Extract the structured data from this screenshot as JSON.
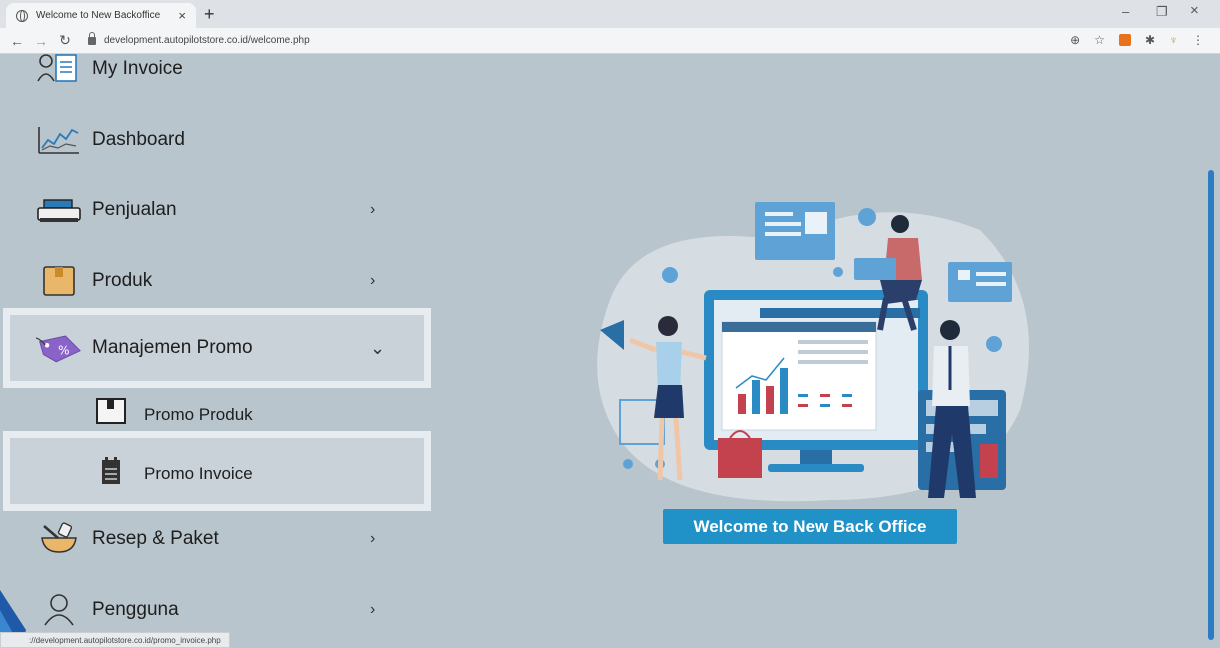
{
  "browser": {
    "tab_title": "Welcome to New Backoffice",
    "tab_close": "×",
    "new_tab": "+",
    "url": "development.autopilotstore.co.id/welcome.php",
    "status_url": "://development.autopilotstore.co.id/promo_invoice.php",
    "minimize": "–",
    "restore": "❐",
    "close": "×"
  },
  "sidebar": {
    "items": [
      {
        "label": "My Invoice",
        "icon": "invoice-icon"
      },
      {
        "label": "Dashboard",
        "icon": "dashboard-chart-icon"
      },
      {
        "label": "Penjualan",
        "icon": "cash-register-icon",
        "chevron": "›"
      },
      {
        "label": "Produk",
        "icon": "product-box-icon",
        "chevron": "›"
      },
      {
        "label": "Manajemen Promo",
        "icon": "promo-tag-icon",
        "chevron": "⌄"
      },
      {
        "label": "Resep & Paket",
        "icon": "mortar-pestle-icon",
        "chevron": "›"
      },
      {
        "label": "Pengguna",
        "icon": "user-icon",
        "chevron": "›"
      }
    ],
    "sub_items": [
      {
        "label": "Promo Produk",
        "icon": "box-icon"
      },
      {
        "label": "Promo Invoice",
        "icon": "calendar-icon"
      }
    ]
  },
  "main": {
    "welcome_button": "Welcome to New Back Office"
  },
  "colors": {
    "accent": "#2192c8",
    "background": "#b9c5cd",
    "promo_tag": "#8a63c9"
  }
}
